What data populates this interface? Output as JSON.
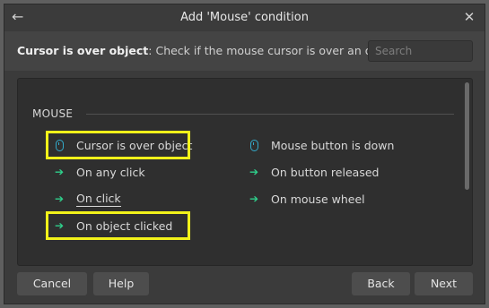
{
  "title": "Add 'Mouse' condition",
  "description": {
    "name": "Cursor is over object",
    "text": ": Check if the mouse cursor is over an object."
  },
  "search": {
    "placeholder": "Search"
  },
  "group": {
    "label": "MOUSE"
  },
  "items": [
    {
      "label": "Cursor is over object",
      "icon": "mouse-icon",
      "highlighted": true
    },
    {
      "label": "On any click",
      "icon": "arrow-right-icon"
    },
    {
      "label": "On click",
      "icon": "arrow-right-icon",
      "underlined": true
    },
    {
      "label": "On object clicked",
      "icon": "arrow-right-icon",
      "highlighted": true
    },
    {
      "label": "Mouse button is down",
      "icon": "mouse-icon"
    },
    {
      "label": "On button released",
      "icon": "arrow-right-icon"
    },
    {
      "label": "On mouse wheel",
      "icon": "arrow-right-icon"
    }
  ],
  "buttons": {
    "cancel": "Cancel",
    "help": "Help",
    "back": "Back",
    "next": "Next"
  },
  "colors": {
    "highlight": "#f2f21a",
    "arrow": "#2fcf8b",
    "mouse_icon": "#33a9c9"
  }
}
